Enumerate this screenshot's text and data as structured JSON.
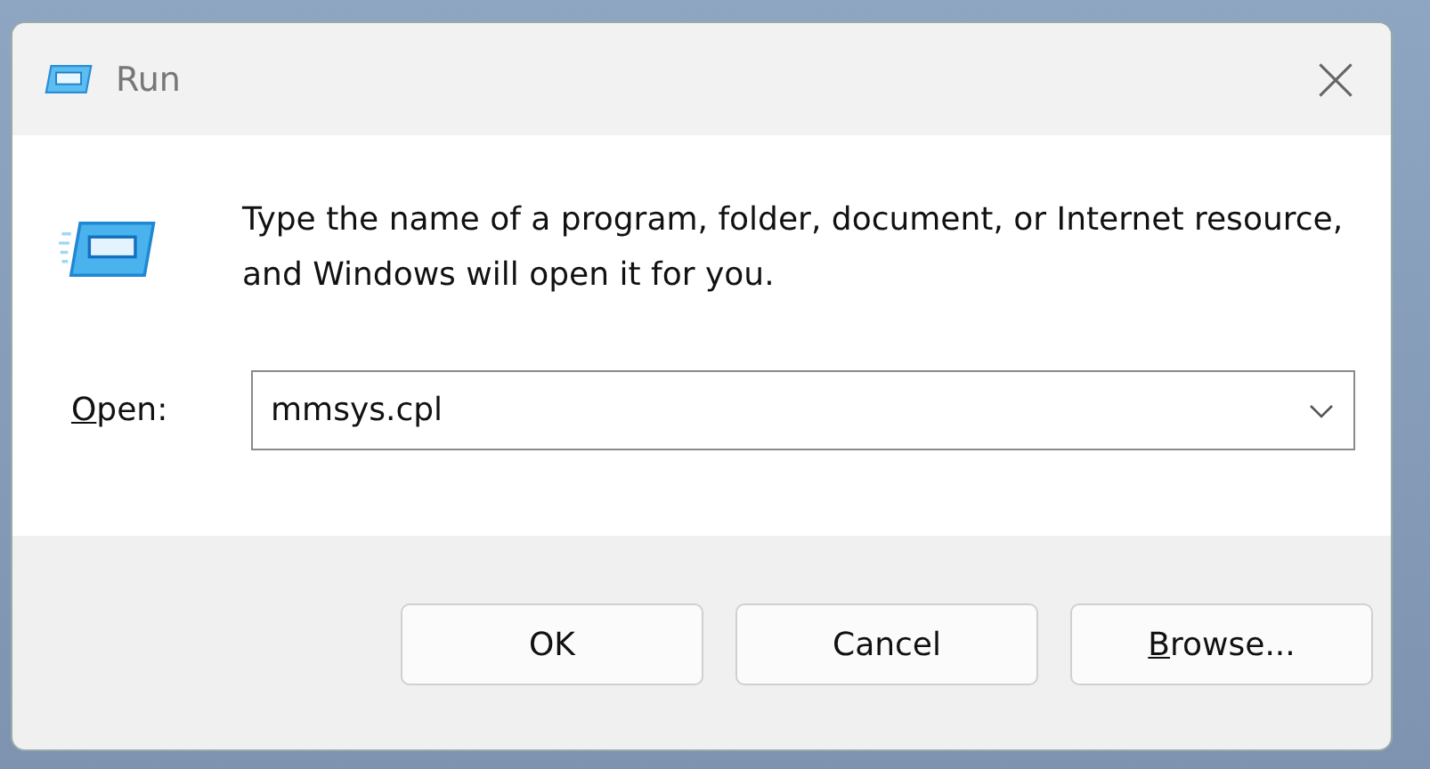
{
  "window": {
    "title": "Run"
  },
  "description": "Type the name of a program, folder, document, or Internet resource, and Windows will open it for you.",
  "open_field": {
    "label": "Open:",
    "first_letter_underlined": true,
    "value": "mmsys.cpl"
  },
  "buttons": [
    {
      "label": "OK",
      "first_letter_underlined": false
    },
    {
      "label": "Cancel",
      "first_letter_underlined": false
    },
    {
      "label": "Browse...",
      "first_letter_underlined": true
    }
  ]
}
